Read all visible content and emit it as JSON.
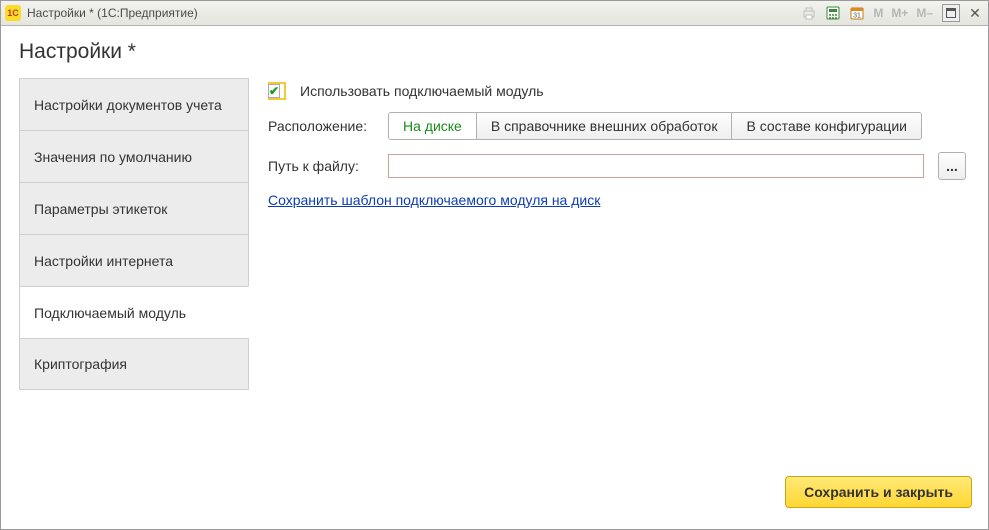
{
  "titlebar": {
    "product_logo": "1C",
    "title": "Настройки *  (1С:Предприятие)",
    "memory_m": "M",
    "memory_mplus": "M+",
    "memory_mminus": "M–"
  },
  "page": {
    "title": "Настройки *"
  },
  "sidebar": {
    "items": [
      {
        "label": "Настройки документов учета"
      },
      {
        "label": "Значения по умолчанию"
      },
      {
        "label": "Параметры этикеток"
      },
      {
        "label": "Настройки интернета"
      },
      {
        "label": "Подключаемый модуль"
      },
      {
        "label": "Криптография"
      }
    ],
    "active_index": 4
  },
  "main": {
    "use_plugin_label": "Использовать подключаемый модуль",
    "use_plugin_checked": true,
    "location_label": "Расположение:",
    "location_options": [
      "На диске",
      "В справочнике внешних обработок",
      "В составе конфигурации"
    ],
    "location_active_index": 0,
    "path_label": "Путь к файлу:",
    "path_value": "",
    "picker_label": "...",
    "save_template_link": "Сохранить шаблон подключаемого модуля на диск"
  },
  "footer": {
    "save_close_label": "Сохранить и закрыть"
  }
}
